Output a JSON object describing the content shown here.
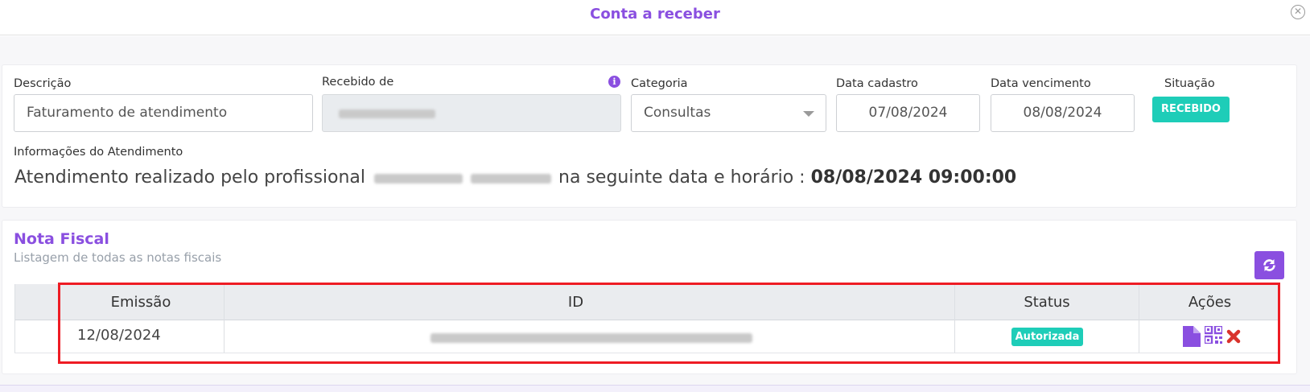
{
  "modal": {
    "title": "Conta a receber",
    "close_icon": "close-circle-icon"
  },
  "form": {
    "descricao_label": "Descrição",
    "descricao_value": "Faturamento de atendimento",
    "recebido_label": "Recebido de",
    "categoria_label": "Categoria",
    "categoria_value": "Consultas",
    "data_cadastro_label": "Data cadastro",
    "data_cadastro_value": "07/08/2024",
    "data_vencimento_label": "Data vencimento",
    "data_vencimento_value": "08/08/2024",
    "situacao_label": "Situação",
    "situacao_value": "RECEBIDO"
  },
  "atendimento": {
    "label": "Informações do Atendimento",
    "text_prefix": "Atendimento realizado pelo profissional",
    "text_middle": "na seguinte data e horário :",
    "datetime": "08/08/2024 09:00:00"
  },
  "nota_fiscal": {
    "title": "Nota Fiscal",
    "subtitle": "Listagem de todas as notas fiscais",
    "columns": [
      "Emissão",
      "ID",
      "Status",
      "Ações"
    ],
    "rows": [
      {
        "emissao": "12/08/2024",
        "status": "Autorizada"
      }
    ]
  },
  "colors": {
    "accent": "#8a4fe0",
    "status_green": "#1ecdb8",
    "highlight": "#ee1c24",
    "delete_red": "#d9322b"
  }
}
